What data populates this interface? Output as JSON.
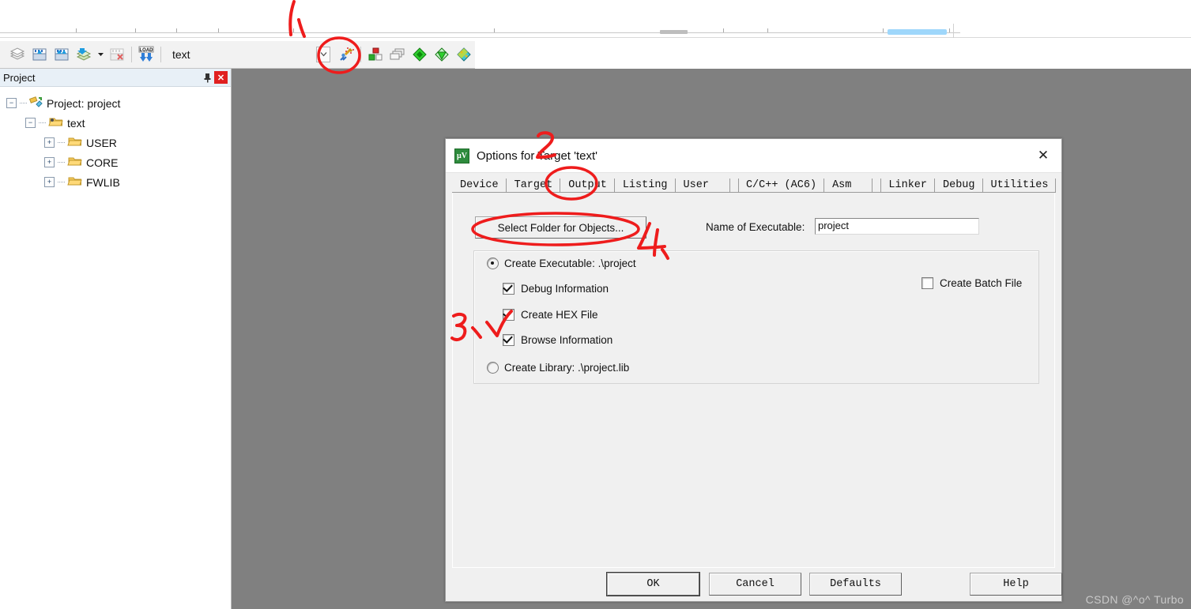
{
  "toolbar": {
    "icons": [
      {
        "name": "batch-build-icon",
        "label": "Batch Build"
      },
      {
        "name": "translate-file-icon",
        "label": "Translate"
      },
      {
        "name": "build-target-icon",
        "label": "Build"
      },
      {
        "name": "rebuild-all-icon",
        "label": "Rebuild all target files"
      },
      {
        "name": "batch-build-dropdown-icon",
        "label": "Batch Build Options"
      },
      {
        "name": "stop-build-icon",
        "label": "Stop Build"
      },
      {
        "name": "load-icon",
        "label": "LOAD"
      }
    ],
    "target_name": "text",
    "right_icons": [
      {
        "name": "select-target-dropdown-icon",
        "label": "Select Target"
      },
      {
        "name": "options-for-target-icon",
        "label": "Options for Target"
      },
      {
        "name": "manage-components-icon",
        "label": "Manage Project Items"
      },
      {
        "name": "multi-project-icon",
        "label": "Manage Multi-Project Workspace"
      },
      {
        "name": "pack-installer-icon",
        "label": "Pack Installer"
      },
      {
        "name": "run-utility-icon",
        "label": "Configuration Wizard"
      },
      {
        "name": "manage-rte-icon",
        "label": "Manage Run-Time Environment"
      }
    ]
  },
  "project_panel": {
    "title": "Project",
    "pin_icon": "pin-icon",
    "close_icon": "close-icon",
    "tree": [
      {
        "label": "Project: project",
        "expander": "−",
        "depth": 0,
        "icon": "project-icon"
      },
      {
        "label": "text",
        "expander": "−",
        "depth": 1,
        "icon": "target-folder-icon"
      },
      {
        "label": "USER",
        "expander": "+",
        "depth": 2,
        "icon": "folder-icon"
      },
      {
        "label": "CORE",
        "expander": "+",
        "depth": 2,
        "icon": "folder-icon"
      },
      {
        "label": "FWLIB",
        "expander": "+",
        "depth": 2,
        "icon": "folder-icon"
      }
    ]
  },
  "dialog": {
    "title": "Options for Target 'text'",
    "icon": "keil-vision-icon",
    "close_icon": "close-icon",
    "tabs": [
      {
        "label": "Device",
        "selected": false
      },
      {
        "label": "Target",
        "selected": false
      },
      {
        "label": "Output",
        "selected": true
      },
      {
        "label": "Listing",
        "selected": false
      },
      {
        "label": "User",
        "selected": false
      },
      {
        "label": "C/C++ (AC6)",
        "selected": false,
        "gap": true
      },
      {
        "label": "Asm",
        "selected": false
      },
      {
        "label": "Linker",
        "selected": false,
        "gap": true
      },
      {
        "label": "Debug",
        "selected": false
      },
      {
        "label": "Utilities",
        "selected": false
      }
    ],
    "output_tab": {
      "select_folder_button": "Select Folder for Objects...",
      "name_of_executable_label": "Name of Executable:",
      "name_of_executable_value": "project",
      "create_executable": {
        "label": "Create Executable:  .\\project",
        "checked": true
      },
      "options": [
        {
          "label": "Debug Information",
          "checked": true
        },
        {
          "label": "Create HEX File",
          "checked": true
        },
        {
          "label": "Browse Information",
          "checked": true
        }
      ],
      "create_batch_file": {
        "label": "Create Batch File",
        "checked": false
      },
      "create_library": {
        "label": "Create Library:  .\\project.lib",
        "checked": false
      }
    },
    "buttons": [
      {
        "label": "OK",
        "name": "ok-button",
        "default": true
      },
      {
        "label": "Cancel",
        "name": "cancel-button",
        "default": false
      },
      {
        "label": "Defaults",
        "name": "defaults-button",
        "default": false
      },
      {
        "label": "Help",
        "name": "help-button",
        "default": false
      }
    ]
  },
  "annotations": {
    "color": "#ee1c1c",
    "marks": [
      {
        "name": "annotation-stroke-1",
        "text": "1"
      },
      {
        "name": "annotation-circle-options-icon",
        "text": ""
      },
      {
        "name": "annotation-digit-2",
        "text": "2"
      },
      {
        "name": "annotation-circle-output-tab",
        "text": ""
      },
      {
        "name": "annotation-circle-select-folder",
        "text": ""
      },
      {
        "name": "annotation-digit-4",
        "text": "4"
      },
      {
        "name": "annotation-digit-3",
        "text": "3"
      },
      {
        "name": "annotation-check-hex",
        "text": ""
      }
    ]
  },
  "watermark": "CSDN @^o^ Turbo"
}
